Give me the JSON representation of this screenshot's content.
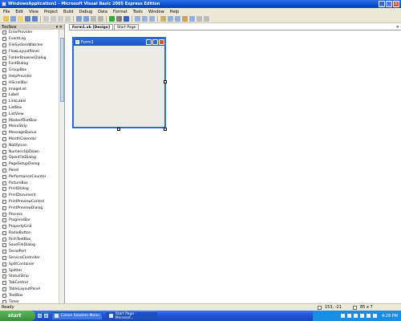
{
  "window": {
    "title": "WindowsApplication1 - Microsoft Visual Basic 2005 Express Edition"
  },
  "menu": [
    "File",
    "Edit",
    "View",
    "Project",
    "Build",
    "Debug",
    "Data",
    "Format",
    "Tools",
    "Window",
    "Help"
  ],
  "toolbox": {
    "title": "Toolbox",
    "items": [
      "ErrorProvider",
      "EventLog",
      "FileSystemWatcher",
      "FlowLayoutPanel",
      "FolderBrowserDialog",
      "FontDialog",
      "GroupBox",
      "HelpProvider",
      "HScrollBar",
      "ImageList",
      "Label",
      "LinkLabel",
      "ListBox",
      "ListView",
      "MaskedTextBox",
      "MenuStrip",
      "MessageQueue",
      "MonthCalendar",
      "NotifyIcon",
      "NumericUpDown",
      "OpenFileDialog",
      "PageSetupDialog",
      "Panel",
      "PerformanceCounter",
      "PictureBox",
      "PrintDialog",
      "PrintDocument",
      "PrintPreviewControl",
      "PrintPreviewDialog",
      "Process",
      "ProgressBar",
      "PropertyGrid",
      "RadioButton",
      "RichTextBox",
      "SaveFileDialog",
      "SerialPort",
      "ServiceController",
      "SplitContainer",
      "Splitter",
      "StatusStrip",
      "TabControl",
      "TableLayoutPanel",
      "TextBox",
      "Timer"
    ]
  },
  "tabs": [
    {
      "label": "Form1.vb [Design]"
    },
    {
      "label": "Start Page"
    }
  ],
  "form": {
    "title": "Form1"
  },
  "status": {
    "text": "Ready",
    "position": "153, -21",
    "size": "85 x 7"
  },
  "taskbar": {
    "start_label": "start",
    "tasks": [
      "Canon Solution Menu",
      "Start Page - Microsof..."
    ],
    "clock": "4:29 PM"
  }
}
